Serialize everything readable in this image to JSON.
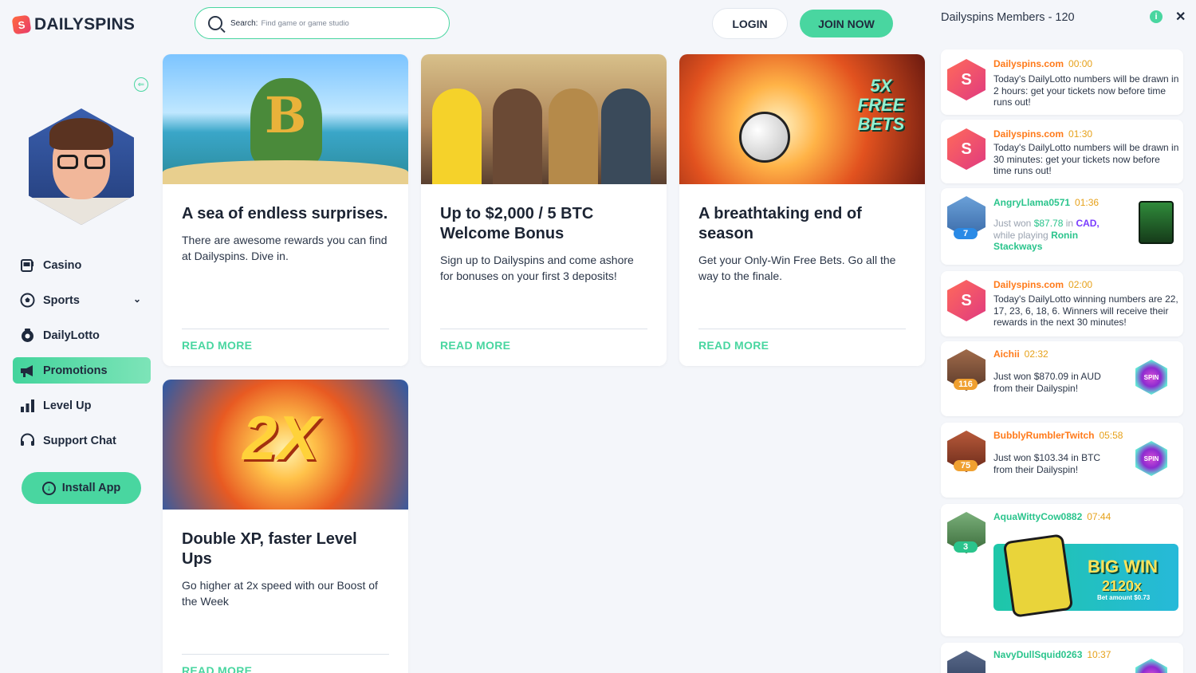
{
  "brand": {
    "logo_mark": "S",
    "name": "DAILYSPINS"
  },
  "sidebar": {
    "collapse_icon": "collapse-icon",
    "nav": [
      {
        "label": "Casino",
        "icon": "slot-machine-icon"
      },
      {
        "label": "Sports",
        "icon": "soccer-ball-icon",
        "has_submenu": true
      },
      {
        "label": "DailyLotto",
        "icon": "lotto-icon"
      },
      {
        "label": "Promotions",
        "icon": "megaphone-icon",
        "active": true
      },
      {
        "label": "Level Up",
        "icon": "bar-chart-icon"
      },
      {
        "label": "Support Chat",
        "icon": "headset-icon"
      }
    ],
    "install_label": "Install App"
  },
  "header": {
    "search_label": "Search:",
    "search_placeholder": "Find game or game studio",
    "login_label": "LOGIN",
    "join_label": "JOIN NOW"
  },
  "promotions": [
    {
      "title": "A sea of endless surprises.",
      "desc": "There are awesome rewards you can find at Dailyspins. Dive in.",
      "cta": "READ MORE"
    },
    {
      "title": "Up to $2,000 / 5 BTC Welcome Bonus",
      "desc": "Sign up to Dailyspins and come ashore for bonuses on your first 3 deposits!",
      "cta": "READ MORE"
    },
    {
      "title": "A breathtaking end of season",
      "desc": "Get your Only-Win Free Bets. Go all the way to the finale.",
      "cta": "READ MORE",
      "art_text": "5X FREE BETS"
    },
    {
      "title": "Double XP, faster Level Ups",
      "desc": "Go higher at 2x speed with our Boost of the Week",
      "cta": "READ MORE",
      "art_text": "2X"
    }
  ],
  "panel": {
    "title": "Dailyspins Members - 120",
    "messages": [
      {
        "name": "Dailyspins.com",
        "time": "00:00",
        "text": "Today's DailyLotto numbers will be drawn in 2 hours: get your tickets now before time runs out!",
        "type": "system"
      },
      {
        "name": "Dailyspins.com",
        "time": "01:30",
        "text": "Today's DailyLotto numbers will be drawn in 30 minutes: get your tickets now before time runs out!",
        "type": "system"
      },
      {
        "name": "AngryLlama0571",
        "time": "01:36",
        "level": "7",
        "won_prefix": "Just won",
        "amount": "$87.78",
        "in_word": "in",
        "currency": "CAD,",
        "playing_prefix": "while playing",
        "game": "Ronin Stackways",
        "type": "win-game"
      },
      {
        "name": "Dailyspins.com",
        "time": "02:00",
        "text": "Today's DailyLotto winning numbers are 22, 17, 23, 6, 18, 6. Winners will receive their rewards in the next 30 minutes!",
        "type": "system"
      },
      {
        "name": "Aichii",
        "time": "02:32",
        "level": "116",
        "text": "Just won $870.09 in AUD from their Dailyspin!",
        "spin_label": "SPIN",
        "type": "win-spin"
      },
      {
        "name": "BubblyRumblerTwitch",
        "time": "05:58",
        "level": "75",
        "text": "Just won $103.34 in BTC from their Dailyspin!",
        "spin_label": "SPIN",
        "type": "win-spin"
      },
      {
        "name": "AquaWittyCow0882",
        "time": "07:44",
        "level": "3",
        "bigwin_title": "BIG WIN",
        "bigwin_mult": "2120x",
        "bigwin_bet": "Bet amount $0.73",
        "type": "bigwin"
      },
      {
        "name": "NavyDullSquid0263",
        "time": "10:37",
        "type": "partial"
      }
    ]
  },
  "colors": {
    "accent": "#49d6a0",
    "system_name": "#ff7a1a",
    "time": "#e6a11a",
    "user_name": "#2ac48c",
    "amount": "#2ac48c",
    "currency": "#7a3cff",
    "level_blue": "#2a8ae6",
    "level_orange": "#f0a030",
    "level_green": "#2ac48c"
  }
}
